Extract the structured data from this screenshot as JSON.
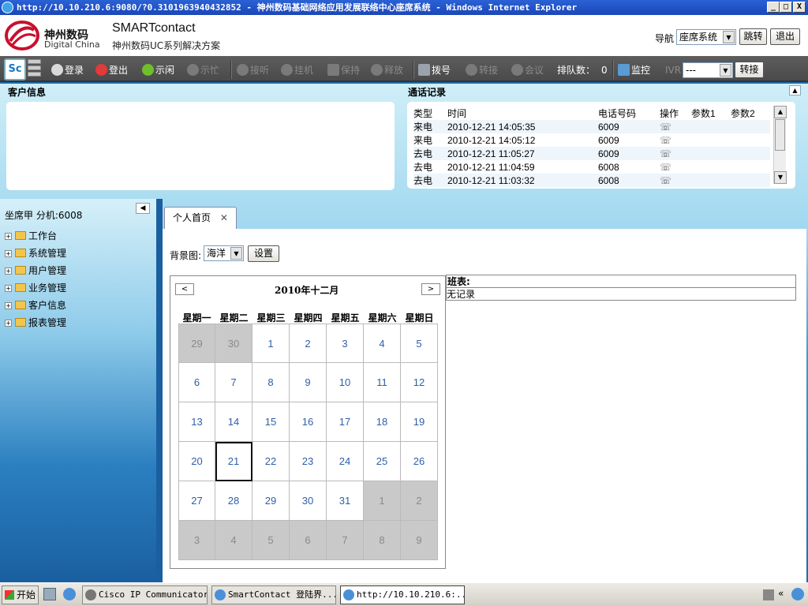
{
  "window": {
    "title": "http://10.10.210.6:9080/?0.3101963940432852 - 神州数码基础网络应用发展联络中心座席系统 - Windows Internet Explorer",
    "buttons": [
      "_",
      "□",
      "X"
    ]
  },
  "header": {
    "brand_cn": "神州数码",
    "brand_en": "Digital China",
    "app_name": "SMARTcontact",
    "app_sub": "神州数码UC系列解决方案",
    "nav_label": "导航",
    "nav_select": "座席系统",
    "jump_button": "跳转",
    "exit_button": "退出"
  },
  "toolbar": {
    "logo": "Sc",
    "items": [
      {
        "label": "登录",
        "icon": "login-icon",
        "state": "enabled",
        "color": "#d9d9d9"
      },
      {
        "label": "登出",
        "icon": "logout-icon",
        "state": "enabled",
        "color": "#e03a3a"
      },
      {
        "label": "示闲",
        "icon": "idle-check-icon",
        "state": "enabled",
        "color": "#6fbf2a"
      },
      {
        "label": "示忙",
        "icon": "busy-icon",
        "state": "disabled"
      },
      {
        "label": "接听",
        "icon": "answer-icon",
        "state": "disabled"
      },
      {
        "label": "挂机",
        "icon": "hangup-icon",
        "state": "disabled"
      },
      {
        "label": "保持",
        "icon": "hold-lock-icon",
        "state": "disabled"
      },
      {
        "label": "释放",
        "icon": "release-icon",
        "state": "disabled"
      },
      {
        "label": "拨号",
        "icon": "dial-keypad-icon",
        "state": "enabled"
      },
      {
        "label": "转接",
        "icon": "transfer-icon",
        "state": "disabled"
      },
      {
        "label": "会议",
        "icon": "conference-icon",
        "state": "disabled"
      }
    ],
    "queue_label": "排队数：",
    "queue_count": "0",
    "monitor_label": "监控",
    "ivr_label": "IVR",
    "ivr_select": "---",
    "transfer_button": "转接"
  },
  "customer": {
    "title": "客户信息"
  },
  "call_log": {
    "title": "通话记录",
    "columns": [
      "类型",
      "时间",
      "电话号码",
      "操作",
      "参数1",
      "参数2"
    ],
    "rows": [
      {
        "type": "来电",
        "time": "2010-12-21 14:05:35",
        "number": "6009"
      },
      {
        "type": "来电",
        "time": "2010-12-21 14:05:12",
        "number": "6009"
      },
      {
        "type": "去电",
        "time": "2010-12-21 11:05:27",
        "number": "6009"
      },
      {
        "type": "去电",
        "time": "2010-12-21 11:04:59",
        "number": "6008"
      },
      {
        "type": "去电",
        "time": "2010-12-21 11:03:32",
        "number": "6008"
      }
    ]
  },
  "agent": {
    "label": "坐席甲 分机:6008"
  },
  "tree": [
    "工作台",
    "系统管理",
    "用户管理",
    "业务管理",
    "客户信息",
    "报表管理"
  ],
  "tab": {
    "label": "个人首页",
    "close": "✕"
  },
  "background": {
    "label": "背景图:",
    "select": "海洋",
    "set_button": "设置"
  },
  "calendar": {
    "title": "2010年十二月",
    "weekdays": [
      "星期一",
      "星期二",
      "星期三",
      "星期四",
      "星期五",
      "星期六",
      "星期日"
    ],
    "days": [
      [
        "29",
        "30",
        "1",
        "2",
        "3",
        "4",
        "5"
      ],
      [
        "6",
        "7",
        "8",
        "9",
        "10",
        "11",
        "12"
      ],
      [
        "13",
        "14",
        "15",
        "16",
        "17",
        "18",
        "19"
      ],
      [
        "20",
        "21",
        "22",
        "23",
        "24",
        "25",
        "26"
      ],
      [
        "27",
        "28",
        "29",
        "30",
        "31",
        "1",
        "2"
      ],
      [
        "3",
        "4",
        "5",
        "6",
        "7",
        "8",
        "9"
      ]
    ],
    "selected_day": "21"
  },
  "schedule": {
    "title": "班表:",
    "value": "无记录"
  },
  "taskbar": {
    "start": "开始",
    "tasks": [
      {
        "label": "Cisco IP Communicator"
      },
      {
        "label": "SmartContact 登陆界..."
      },
      {
        "label": "http://10.10.210.6:..."
      }
    ]
  }
}
